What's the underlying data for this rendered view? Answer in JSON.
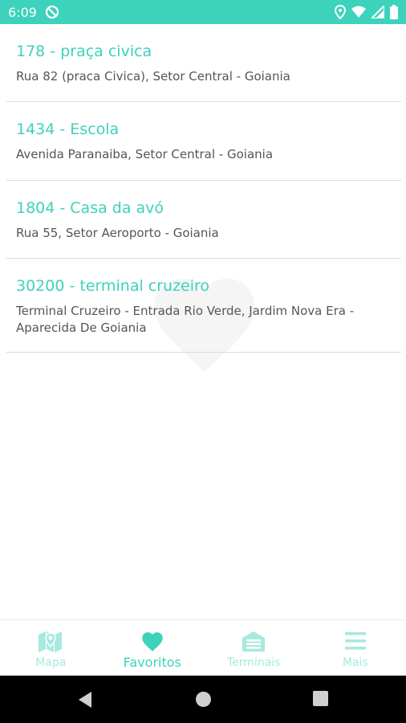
{
  "status_bar": {
    "time": "6:09",
    "left_icons": [
      "sync-off-icon"
    ],
    "right_icons": [
      "location-icon",
      "wifi-icon",
      "signal-icon",
      "battery-icon"
    ]
  },
  "favorites": [
    {
      "title": "178 - praça civica",
      "address": "Rua 82 (praca Civica), Setor Central - Goiania"
    },
    {
      "title": "1434 - Escola",
      "address": "Avenida Paranaiba, Setor Central - Goiania"
    },
    {
      "title": "1804 - Casa da avó",
      "address": "Rua 55, Setor Aeroporto - Goiania"
    },
    {
      "title": "30200 - terminal cruzeiro",
      "address": "Terminal Cruzeiro - Entrada Rio Verde, Jardim Nova Era - Aparecida De Goiania"
    }
  ],
  "bottom_nav": {
    "items": [
      {
        "label": "Mapa",
        "icon": "map-icon",
        "active": false
      },
      {
        "label": "Favoritos",
        "icon": "heart-icon",
        "active": true
      },
      {
        "label": "Terminais",
        "icon": "garage-icon",
        "active": false
      },
      {
        "label": "Mais",
        "icon": "menu-icon",
        "active": false
      }
    ]
  },
  "colors": {
    "accent": "#3dd2bb",
    "accent_light": "#a7e9df",
    "address_text": "#555555",
    "divider": "#dcdcdc"
  },
  "system_nav": [
    "back-icon",
    "home-icon",
    "recents-icon"
  ]
}
